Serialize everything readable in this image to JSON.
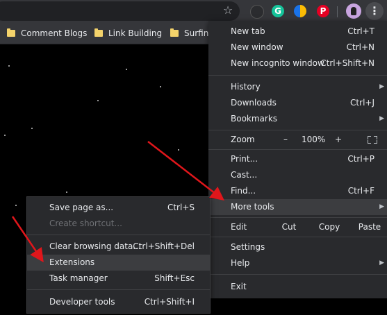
{
  "toolbar": {
    "extensions": [
      "toggle-off-icon",
      "grammarly-icon",
      "dark-mode-icon",
      "pinterest-icon"
    ],
    "grammarly_letter": "G",
    "pinterest_letter": "P"
  },
  "bookmarks": [
    {
      "label": "Comment Blogs"
    },
    {
      "label": "Link Building"
    },
    {
      "label": "Surfing"
    }
  ],
  "menu": {
    "new_tab": {
      "label": "New tab",
      "shortcut": "Ctrl+T"
    },
    "new_window": {
      "label": "New window",
      "shortcut": "Ctrl+N"
    },
    "new_incognito": {
      "label": "New incognito window",
      "shortcut": "Ctrl+Shift+N"
    },
    "history": {
      "label": "History"
    },
    "downloads": {
      "label": "Downloads",
      "shortcut": "Ctrl+J"
    },
    "bookmarks": {
      "label": "Bookmarks"
    },
    "zoom": {
      "label": "Zoom",
      "minus": "–",
      "value": "100%",
      "plus": "+"
    },
    "print": {
      "label": "Print...",
      "shortcut": "Ctrl+P"
    },
    "cast": {
      "label": "Cast..."
    },
    "find": {
      "label": "Find...",
      "shortcut": "Ctrl+F"
    },
    "more_tools": {
      "label": "More tools"
    },
    "edit": {
      "label": "Edit",
      "cut": "Cut",
      "copy": "Copy",
      "paste": "Paste"
    },
    "settings": {
      "label": "Settings"
    },
    "help": {
      "label": "Help"
    },
    "exit": {
      "label": "Exit"
    }
  },
  "submenu": {
    "save_page": {
      "label": "Save page as...",
      "shortcut": "Ctrl+S"
    },
    "create_shortcut": {
      "label": "Create shortcut..."
    },
    "clear_data": {
      "label": "Clear browsing data...",
      "shortcut": "Ctrl+Shift+Del"
    },
    "extensions": {
      "label": "Extensions"
    },
    "task_manager": {
      "label": "Task manager",
      "shortcut": "Shift+Esc"
    },
    "dev_tools": {
      "label": "Developer tools",
      "shortcut": "Ctrl+Shift+I"
    }
  },
  "colors": {
    "menu_bg": "#292a2d",
    "highlight": "#3c3d40",
    "annotation_arrow": "#e0161b",
    "toolbar": "#35363a"
  }
}
